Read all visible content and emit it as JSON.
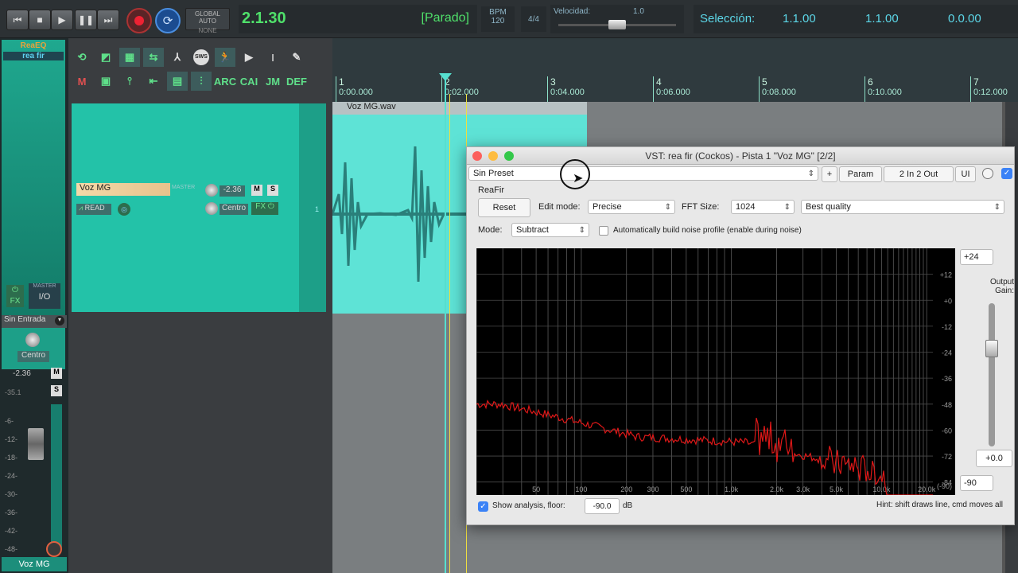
{
  "transport": {
    "global_auto_label": "GLOBAL AUTO",
    "global_auto_value": "NONE",
    "position": "2.1.30",
    "state": "[Parado]",
    "bpm_label": "BPM",
    "bpm_value": "120",
    "time_sig": "4/4",
    "velocity_label": "Velocidad:",
    "velocity_value": "1.0",
    "velocity_level": 0.5,
    "selection_label": "Selección:",
    "sel_start": "1.1.00",
    "sel_end": "1.1.00",
    "sel_length": "0.0.00"
  },
  "toolbar": {
    "sws": "SWS",
    "arc": "ARC",
    "cai": "CAI",
    "jm": "JM",
    "def": "DEF"
  },
  "mixer": {
    "fx1": "ReaEQ",
    "fx2": "rea fir",
    "master": "MASTER",
    "io": "I/O",
    "input": "Sin Entrada",
    "pan": "Centro",
    "vol": "-2.36",
    "peak": "-35.1",
    "scale": [
      "-6-",
      "-12-",
      "-18-",
      "-24-",
      "-30-",
      "-36-",
      "-42-",
      "-48-"
    ],
    "m": "M",
    "s": "S",
    "track_name": "Voz MG"
  },
  "track": {
    "name": "Voz MG",
    "master": "MASTER",
    "vol": "-2.36",
    "pan": "Centro",
    "mute": "M",
    "solo": "S",
    "read": "READ",
    "fx": "FX",
    "number": "1"
  },
  "ruler": {
    "marks": [
      {
        "num": "1",
        "time": "0:00.000"
      },
      {
        "num": "2",
        "time": "0:02.000"
      },
      {
        "num": "3",
        "time": "0:04.000"
      },
      {
        "num": "4",
        "time": "0:06.000"
      },
      {
        "num": "5",
        "time": "0:08.000"
      },
      {
        "num": "6",
        "time": "0:10.000"
      },
      {
        "num": "7",
        "time": "0:12.000"
      }
    ]
  },
  "item": {
    "name": "Voz MG.wav"
  },
  "plugin": {
    "title": "VST: rea fir (Cockos) - Pista 1 \"Voz MG\" [2/2]",
    "preset": "Sin Preset",
    "plus": "+",
    "param": "Param",
    "io": "2 In 2 Out",
    "ui": "UI",
    "name": "ReaFir",
    "reset": "Reset",
    "edit_mode_label": "Edit mode:",
    "edit_mode": "Precise",
    "fft_label": "FFT Size:",
    "fft": "1024",
    "quality": "Best quality",
    "mode_label": "Mode:",
    "mode": "Subtract",
    "auto_label": "Automatically build noise profile (enable during noise)",
    "db_labels": [
      "+12",
      "+0",
      "-12",
      "-24",
      "-36",
      "-48",
      "-60",
      "-72",
      "-84",
      "(-90)"
    ],
    "freq_labels": [
      "50",
      "100",
      "200",
      "300",
      "500",
      "1.0k",
      "2.0k",
      "3.0k",
      "5.0k",
      "10.0k",
      "20.0k"
    ],
    "top_value": "+24",
    "output_gain_label": "Output Gain:",
    "gain_value": "+0.0",
    "bottom_value": "-90",
    "show_analysis": "Show analysis, floor:",
    "floor": "-90.0",
    "db": "dB",
    "hint": "Hint: shift draws line, cmd moves all"
  },
  "colors": {
    "accent": "#23c2a8",
    "waveform_bg": "#5ee3d6",
    "spectrum": "#e01818"
  }
}
